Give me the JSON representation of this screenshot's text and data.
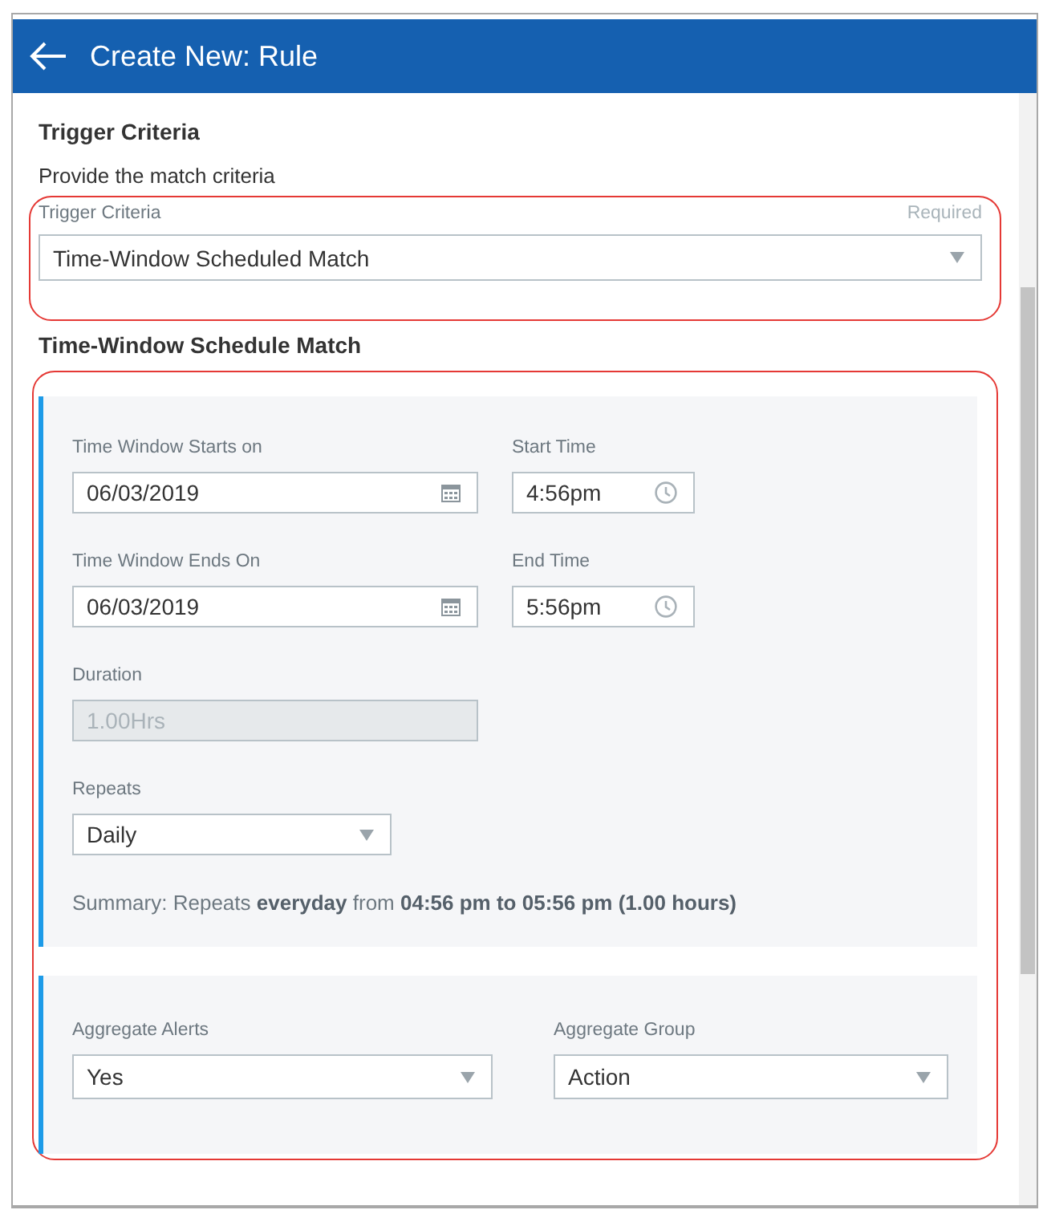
{
  "header": {
    "title": "Create New: Rule"
  },
  "trigger": {
    "heading": "Trigger Criteria",
    "description": "Provide the match criteria",
    "highlighted": true,
    "field": {
      "label": "Trigger Criteria",
      "required_text": "Required",
      "value": "Time-Window Scheduled Match"
    }
  },
  "schedule": {
    "heading": "Time-Window Schedule Match",
    "highlighted": true,
    "start": [
      {
        "label": "Time Window Starts on",
        "value": "06/03/2019",
        "kind": "date"
      },
      {
        "label": "Start Time",
        "value": "4:56pm",
        "kind": "time"
      }
    ],
    "end": [
      {
        "label": "Time Window Ends On",
        "value": "06/03/2019",
        "kind": "date"
      },
      {
        "label": "End Time",
        "value": "5:56pm",
        "kind": "time"
      }
    ],
    "duration": {
      "label": "Duration",
      "value": "1.00Hrs",
      "disabled": true
    },
    "repeats": {
      "label": "Repeats",
      "value": "Daily"
    },
    "summary": "Summary: Repeats **everyday** from **04:56 pm to 05:56 pm (1.00 hours)**",
    "aggregate": [
      {
        "label": "Aggregate Alerts",
        "value": "Yes"
      },
      {
        "label": "Aggregate Group",
        "value": "Action"
      }
    ]
  }
}
